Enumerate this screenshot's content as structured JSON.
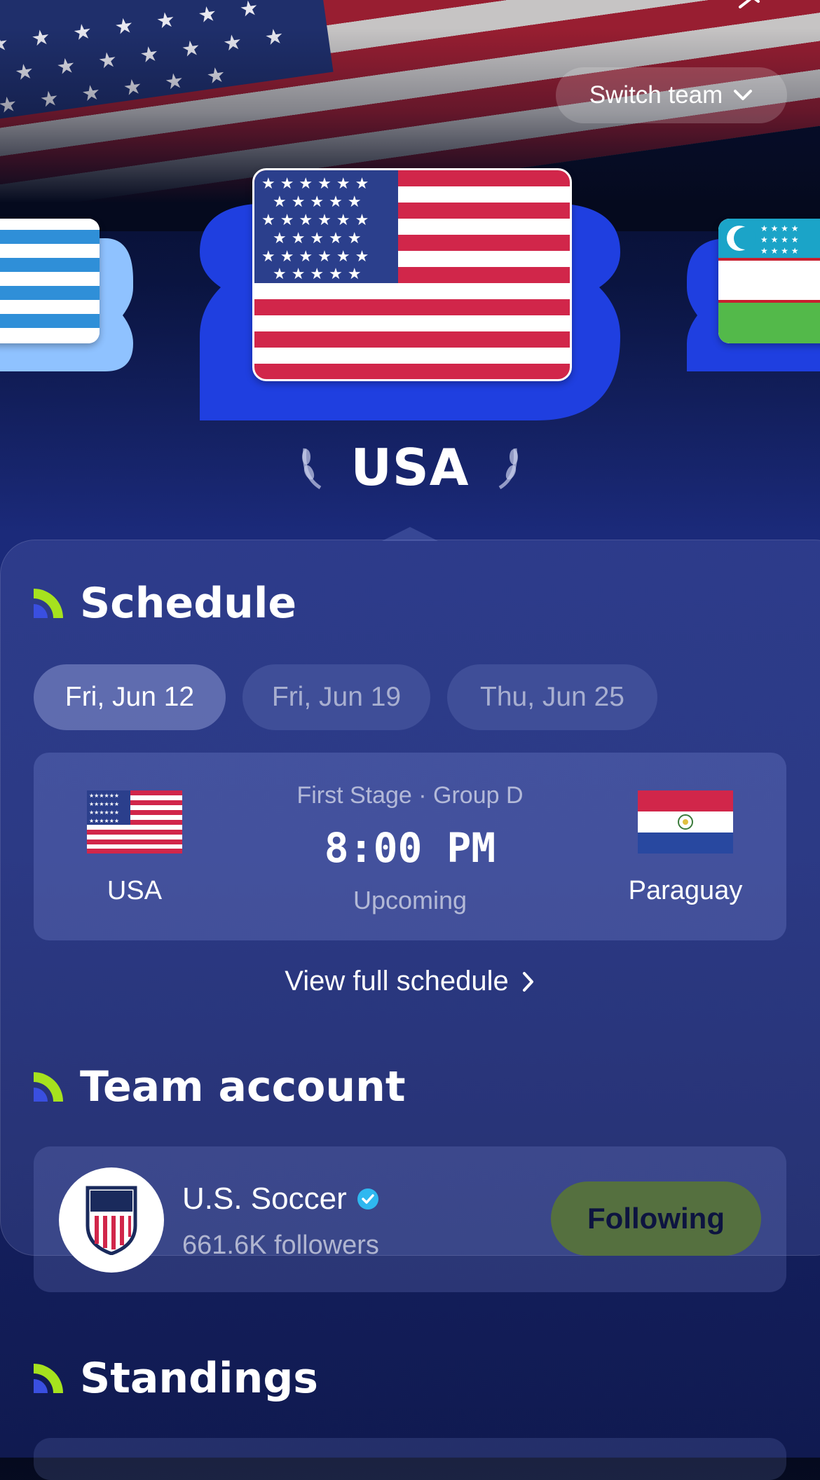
{
  "header": {
    "switch_team_label": "Switch team"
  },
  "team": {
    "name": "USA"
  },
  "schedule": {
    "title": "Schedule",
    "dates": [
      "Fri, Jun 12",
      "Fri, Jun 19",
      "Thu, Jun 25"
    ],
    "selected_date": "Fri, Jun 12",
    "match": {
      "stage": "First Stage · Group D",
      "time": "8:00 PM",
      "status": "Upcoming",
      "home_team": "USA",
      "away_team": "Paraguay"
    },
    "view_full_label": "View full schedule"
  },
  "team_account": {
    "title": "Team account",
    "name": "U.S. Soccer",
    "verified": true,
    "followers": "661.6K followers",
    "follow_button_label": "Following"
  },
  "standings": {
    "title": "Standings"
  },
  "colors": {
    "accent_blue": "#1f3fe0",
    "accent_green": "#a6e21e",
    "following_button": "#55703f",
    "verified_badge": "#2fb8f0"
  },
  "icons": [
    "chevron-down-icon",
    "chevron-right-icon",
    "verified-icon",
    "section-icon",
    "laurel-icon"
  ]
}
